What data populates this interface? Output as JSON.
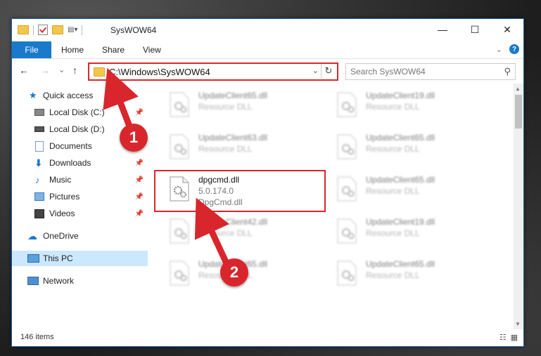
{
  "window": {
    "title": "SysWOW64",
    "controls": {
      "minimize": "—",
      "maximize": "☐",
      "close": "✕"
    }
  },
  "ribbon": {
    "tabs": [
      "File",
      "Home",
      "Share",
      "View"
    ],
    "help": "?"
  },
  "navigation": {
    "back": "←",
    "forward": "→",
    "recent": "⌄",
    "up": "↑"
  },
  "address": {
    "path": "C:\\Windows\\SysWOW64",
    "refresh": "↻"
  },
  "search": {
    "placeholder": "Search SysWOW64"
  },
  "sidebar": {
    "items": [
      {
        "label": "Quick access",
        "icon": "star-icon"
      },
      {
        "label": "Local Disk (C:)",
        "icon": "drive-icon"
      },
      {
        "label": "Local Disk (D:)",
        "icon": "drive-icon"
      },
      {
        "label": "Documents",
        "icon": "documents-icon"
      },
      {
        "label": "Downloads",
        "icon": "download-icon"
      },
      {
        "label": "Music",
        "icon": "music-icon"
      },
      {
        "label": "Pictures",
        "icon": "pictures-icon"
      },
      {
        "label": "Videos",
        "icon": "videos-icon"
      },
      {
        "label": "OneDrive",
        "icon": "cloud-icon"
      },
      {
        "label": "This PC",
        "icon": "computer-icon"
      },
      {
        "label": "Network",
        "icon": "network-icon"
      }
    ],
    "selected": "This PC"
  },
  "files": [
    {
      "name": "UpdateClient65.dll",
      "line1": "Resource DLL",
      "line2": ""
    },
    {
      "name": "UpdateClient19.dll",
      "line1": "Resource DLL",
      "line2": ""
    },
    {
      "name": "UpdateClient63.dll",
      "line1": "Resource DLL",
      "line2": ""
    },
    {
      "name": "UpdateClient65.dll",
      "line1": "Resource DLL",
      "line2": ""
    },
    {
      "name": "dpgcmd.dll",
      "line1": "5.0.174.0",
      "line2": "DpgCmd.dll"
    },
    {
      "name": "UpdateClient65.dll",
      "line1": "Resource DLL",
      "line2": ""
    },
    {
      "name": "UpdateClient42.dll",
      "line1": "Resource DLL",
      "line2": ""
    },
    {
      "name": "UpdateClient19.dll",
      "line1": "Resource DLL",
      "line2": ""
    },
    {
      "name": "UpdateClient65.dll",
      "line1": "Resource DLL",
      "line2": ""
    },
    {
      "name": "UpdateClient65.dll",
      "line1": "Resource DLL",
      "line2": ""
    }
  ],
  "status": {
    "items": "146 items"
  },
  "callouts": [
    "1",
    "2"
  ],
  "colors": {
    "accent": "#1979ca",
    "highlight": "#d9262c",
    "selected": "#cce8ff"
  }
}
